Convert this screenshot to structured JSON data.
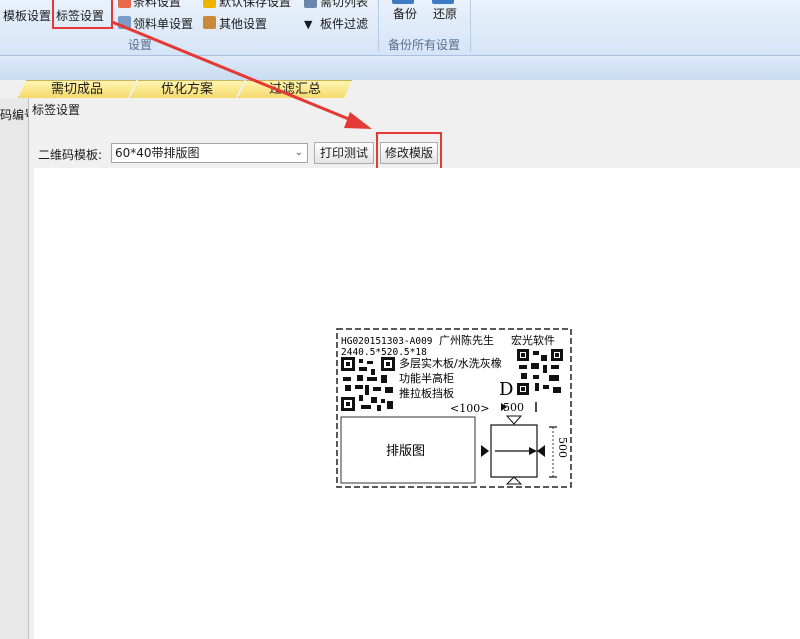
{
  "ribbon": {
    "items": {
      "template_settings": "模板设置",
      "label_settings": "标签设置",
      "material_settings": "条料设置",
      "pick_list_settings": "领料单设置",
      "default_save_settings": "默认保存设置",
      "other_settings": "其他设置",
      "cut_list": "需切列表",
      "panel_filter": "板件过滤",
      "backup": "备份",
      "restore": "还原"
    },
    "groups": {
      "settings": "设置",
      "backup_all": "备份所有设置"
    }
  },
  "tabs": [
    "需切成品",
    "优化方案",
    "过滤汇总"
  ],
  "left_panel_text": "码编号",
  "dialog": {
    "title": "标签设置",
    "qr_template_label": "二维码模板:",
    "qr_template_value": "60*40带排版图",
    "print_test_button": "打印测试",
    "modify_template_button": "修改模版"
  },
  "label_preview": {
    "code": "HG020151303-A009",
    "customer": "广州陈先生",
    "company": "宏光软件",
    "dimensions": "2440.5*520.5*18",
    "material": "多层实木板/水洗灰橡",
    "cabinet": "功能半高柜",
    "part": "推拉板挡板",
    "quantity": "<100>",
    "letter": "D",
    "width_value": "500",
    "height_value": "500",
    "layout_box": "排版图"
  },
  "colors": {
    "highlight_red": "#e53935",
    "tab_yellow": "#f4d86c",
    "ribbon_blue": "#d5e4f6"
  }
}
